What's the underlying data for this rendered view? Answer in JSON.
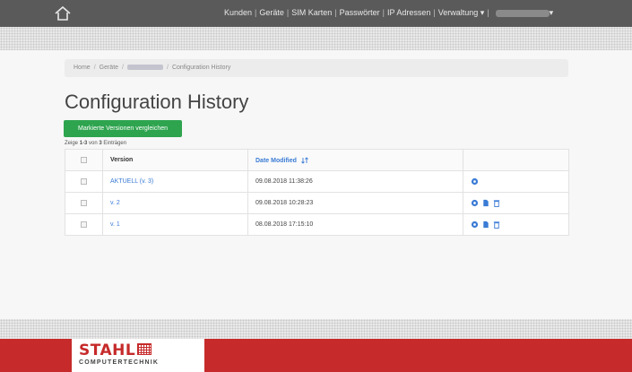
{
  "header": {
    "home_icon": "home-icon",
    "nav": [
      "Kunden",
      "Geräte",
      "SIM Karten",
      "Passwörter",
      "IP Adressen",
      "Verwaltung ▾"
    ],
    "user_menu_suffix": "▾"
  },
  "breadcrumb": {
    "items": [
      "Home",
      "Geräte",
      "Configuration History"
    ],
    "separator": "/"
  },
  "page": {
    "title": "Configuration History",
    "compare_button": "Markierte Versionen vergleichen",
    "count": {
      "prefix": "Zeige",
      "range": "1-3",
      "middle": "von",
      "total": "3",
      "suffix": "Einträgen"
    }
  },
  "table": {
    "headers": [
      "",
      "Version",
      "Date Modified",
      ""
    ],
    "sort_icon": "sort-icon",
    "rows": [
      {
        "version": "AKTUELL (v. 3)",
        "date": "09.08.2018 11:38:26",
        "actions": [
          "view-icon"
        ]
      },
      {
        "version": "v. 2",
        "date": "09.08.2018 10:28:23",
        "actions": [
          "view-icon",
          "restore-icon",
          "trash-icon"
        ]
      },
      {
        "version": "v. 1",
        "date": "08.08.2018 17:15:10",
        "actions": [
          "view-icon",
          "restore-icon",
          "trash-icon"
        ]
      }
    ]
  },
  "footer": {
    "logo_main": "STAHL",
    "logo_sub": "COMPUTERTECHNIK"
  },
  "colors": {
    "topbar": "#5a5a5a",
    "button_green": "#2ea44f",
    "link_blue": "#3a7bd5",
    "footer_red": "#c62a2a"
  }
}
